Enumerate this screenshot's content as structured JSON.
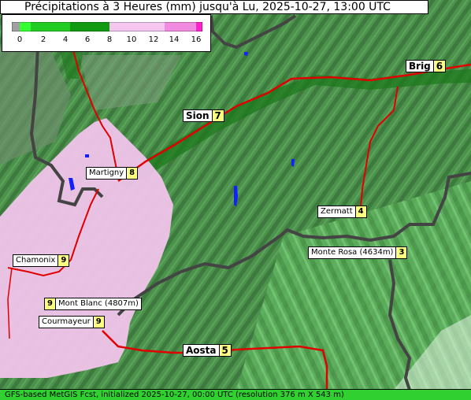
{
  "title": "Précipitations à 3 Heures (mm) jusqu'à Lu, 2025-10-27, 13:00 UTC",
  "legend": {
    "ticks": [
      "0",
      "2",
      "4",
      "6",
      "8",
      "10",
      "12",
      "14",
      "16"
    ],
    "colors": {
      "zero": "#a0a0a0",
      "light_green": "#33ff33",
      "green": "#22cc22",
      "dark_green": "#119911",
      "pink_light": "#f5c6f0",
      "pink": "#f08be0",
      "magenta": "#ff22cc"
    }
  },
  "locations": [
    {
      "name": "Brig",
      "value": "6"
    },
    {
      "name": "Sion",
      "value": "7"
    },
    {
      "name": "Martigny",
      "value": "8"
    },
    {
      "name": "Zermatt",
      "value": "4"
    },
    {
      "name": "Chamonix",
      "value": "9"
    },
    {
      "name": "Monte Rosa (4634m)",
      "value": "3"
    },
    {
      "name": "Mont Blanc (4807m)",
      "value": "9"
    },
    {
      "name": "Courmayeur",
      "value": "9"
    },
    {
      "name": "Aosta",
      "value": "5"
    }
  ],
  "footer": "GFS-based MetGIS Fcst, initialized 2025-10-27, 00:00 UTC  (resolution 376 m X 543 m)",
  "colors": {
    "terrain_green": "#4a8f4a",
    "terrain_dark": "#3a6e3a",
    "precip_pink": "#f5c6f0",
    "road_red": "#e00000",
    "border_gray": "#444444",
    "lake_blue": "#1020ff"
  }
}
